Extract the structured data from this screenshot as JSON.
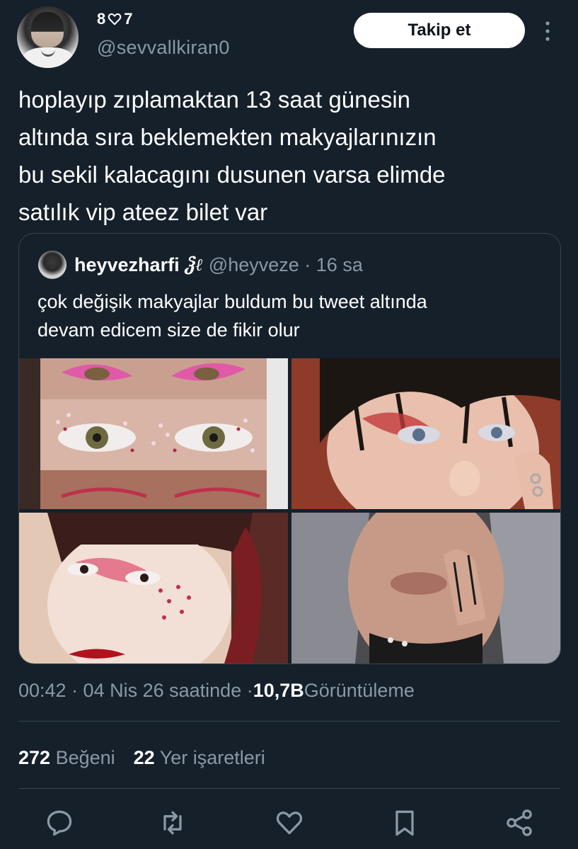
{
  "author": {
    "display_name_left": "8",
    "display_name_right": "7",
    "handle": "@sevvallkiran0",
    "follow_label": "Takip et"
  },
  "tweet": {
    "lines": [
      "hoplayıp zıplamaktan 13 saat günesin",
      "altında sıra beklemekten makyajlarınızın",
      "bu sekil kalacagını dusunen varsa elimde",
      "satılık vip ateez bilet var"
    ]
  },
  "quote": {
    "name": "heyvezharfi",
    "emoji": "ჴℓ",
    "handle_time": "@heyveze · 16 sa",
    "lines": [
      "çok değişik makyajlar buldum bu tweet altında",
      "devam edicem size de fikir olur"
    ]
  },
  "meta": {
    "time_date": "00:42 · 04 Nis 26 saatinde · ",
    "views_count": "10,7B",
    "views_label": " Görüntüleme"
  },
  "stats": {
    "likes_count": "272",
    "likes_label": " Beğeni",
    "bookmarks_count": "22",
    "bookmarks_label": " Yer işaretleri"
  },
  "icons": {
    "reply": "reply-icon",
    "retweet": "retweet-icon",
    "like": "heart-icon",
    "bookmark": "bookmark-icon",
    "share": "share-icon"
  },
  "colors": {
    "background": "#15202b",
    "muted": "#8b98a5",
    "border": "#38444d"
  }
}
